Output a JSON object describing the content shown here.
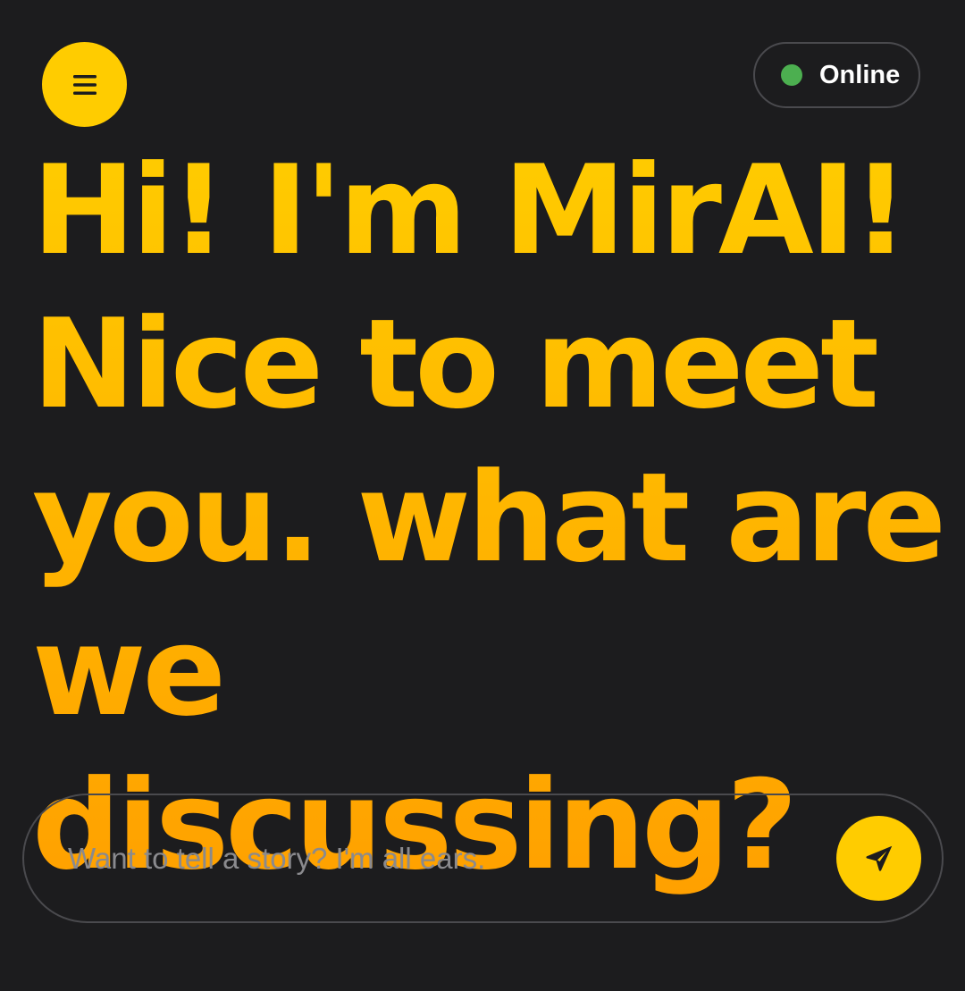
{
  "header": {
    "menu_icon": "hamburger-menu-icon",
    "status": {
      "label": "Online",
      "color": "#4caf50"
    }
  },
  "main": {
    "headline": "Hi! I'm MirAI!\nNice to meet\nyou. what are\nwe discussing?"
  },
  "composer": {
    "placeholder": "Want to tell a story? I'm all ears.",
    "value": "",
    "send_icon": "send-paper-plane-icon"
  },
  "colors": {
    "background": "#1c1c1e",
    "accent": "#ffcc00",
    "accent_dark": "#ffa000",
    "border": "#4a4a4e",
    "online": "#4caf50"
  }
}
